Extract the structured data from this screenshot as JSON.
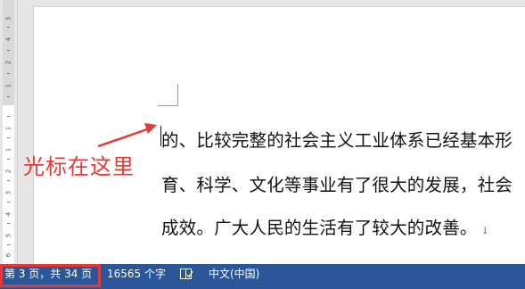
{
  "ruler": {
    "numbers": [
      "4",
      "3",
      "2",
      "1",
      "1",
      "1",
      "2",
      "3",
      "4",
      "5",
      "6"
    ]
  },
  "document": {
    "lines": [
      "的、比较完整的社会主义工业体系已经基本形",
      "育、科学、文化等事业有了很大的发展，社会",
      "成效。广大人民的生活有了较大的改善。"
    ],
    "paragraph_mark": "↓"
  },
  "annotation": {
    "text": "光标在这里",
    "color": "#e53935"
  },
  "statusbar": {
    "page_info": "第 3 页，共 34 页",
    "word_count": "16565 个字",
    "proofing_icon": "proofing-book-icon",
    "language": "中文(中国)",
    "background": "#2b579a",
    "highlight_color": "#e53935"
  }
}
